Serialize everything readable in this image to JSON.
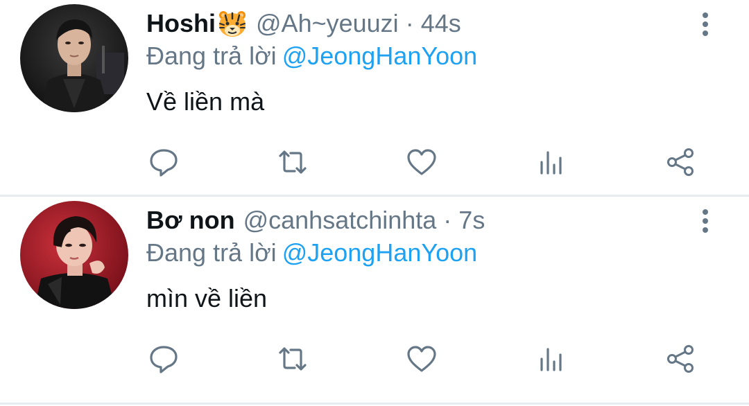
{
  "colors": {
    "accent": "#1da1f2",
    "secondary_text": "#657786",
    "primary_text": "#0f1419",
    "divider": "#e6ecf0"
  },
  "tweets": [
    {
      "display_name": "Hoshi",
      "name_emoji": "tiger-face-emoji",
      "handle": "@Ah~yeuuzi",
      "separator": "·",
      "time": "44s",
      "reply_prefix": "Đang trả lời",
      "reply_to": "@JeongHanYoon",
      "text": "Về liền mà"
    },
    {
      "display_name": "Bơ non",
      "handle": "@canhsatchinhta",
      "separator": "·",
      "time": "7s",
      "reply_prefix": "Đang trả lời",
      "reply_to": "@JeongHanYoon",
      "text": "mìn về liền"
    }
  ],
  "action_icons": [
    "reply-icon",
    "retweet-icon",
    "like-icon",
    "analytics-icon",
    "share-icon"
  ]
}
